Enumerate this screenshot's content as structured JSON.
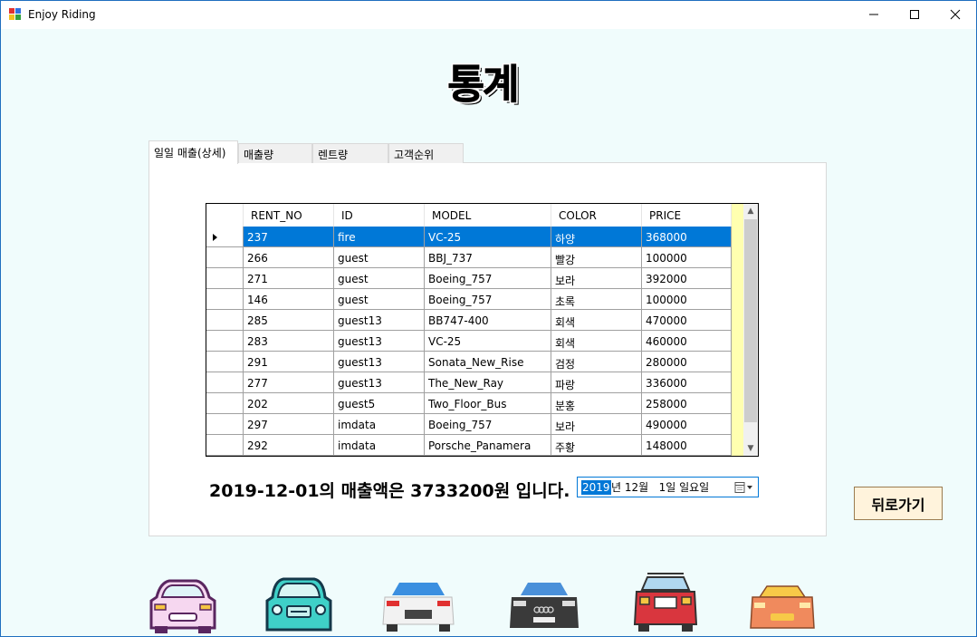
{
  "window": {
    "title": "Enjoy Riding",
    "controls": {
      "minimize": "minimize-icon",
      "maximize": "maximize-icon",
      "close": "close-icon"
    }
  },
  "page_title": "통계",
  "tabs": [
    {
      "label": "일일 매출(상세)",
      "active": true
    },
    {
      "label": "매출량",
      "active": false
    },
    {
      "label": "렌트량",
      "active": false
    },
    {
      "label": "고객순위",
      "active": false
    }
  ],
  "grid": {
    "columns": [
      "RENT_NO",
      "ID",
      "MODEL",
      "COLOR",
      "PRICE"
    ],
    "rows": [
      [
        "237",
        "fire",
        "VC-25",
        "하양",
        "368000"
      ],
      [
        "266",
        "guest",
        "BBJ_737",
        "빨강",
        "100000"
      ],
      [
        "271",
        "guest",
        "Boeing_757",
        "보라",
        "392000"
      ],
      [
        "146",
        "guest",
        "Boeing_757",
        "초록",
        "100000"
      ],
      [
        "285",
        "guest13",
        "BB747-400",
        "회색",
        "470000"
      ],
      [
        "283",
        "guest13",
        "VC-25",
        "회색",
        "460000"
      ],
      [
        "291",
        "guest13",
        "Sonata_New_Rise",
        "검정",
        "280000"
      ],
      [
        "277",
        "guest13",
        "The_New_Ray",
        "파랑",
        "336000"
      ],
      [
        "202",
        "guest5",
        "Two_Floor_Bus",
        "분홍",
        "258000"
      ],
      [
        "297",
        "imdata",
        "Boeing_757",
        "보라",
        "490000"
      ],
      [
        "292",
        "imdata",
        "Porsche_Panamera",
        "주황",
        "148000"
      ]
    ],
    "selected_row": 0
  },
  "summary_text": "2019-12-01의 매출액은 3733200원 입니다.",
  "date_picker": {
    "year": "2019",
    "rest": "년 12월   1일 일요일"
  },
  "back_button": "뒤로가기",
  "colors": {
    "selection": "#0078d7",
    "background": "#f0fcfc",
    "accent_border": "#1f6fbf"
  }
}
